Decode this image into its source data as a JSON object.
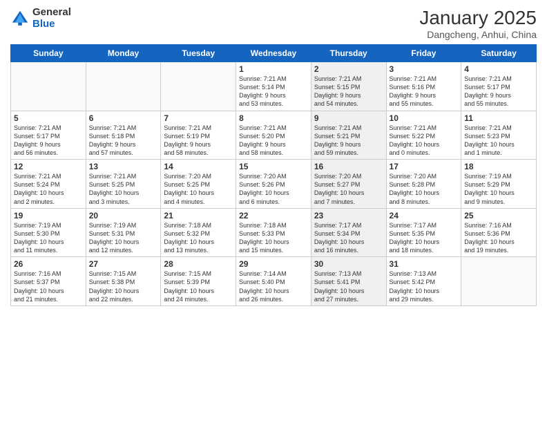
{
  "logo": {
    "general": "General",
    "blue": "Blue"
  },
  "title": "January 2025",
  "subtitle": "Dangcheng, Anhui, China",
  "headers": [
    "Sunday",
    "Monday",
    "Tuesday",
    "Wednesday",
    "Thursday",
    "Friday",
    "Saturday"
  ],
  "weeks": [
    [
      {
        "day": "",
        "info": "",
        "empty": true
      },
      {
        "day": "",
        "info": "",
        "empty": true
      },
      {
        "day": "",
        "info": "",
        "empty": true
      },
      {
        "day": "1",
        "info": "Sunrise: 7:21 AM\nSunset: 5:14 PM\nDaylight: 9 hours\nand 53 minutes."
      },
      {
        "day": "2",
        "info": "Sunrise: 7:21 AM\nSunset: 5:15 PM\nDaylight: 9 hours\nand 54 minutes.",
        "shaded": true
      },
      {
        "day": "3",
        "info": "Sunrise: 7:21 AM\nSunset: 5:16 PM\nDaylight: 9 hours\nand 55 minutes."
      },
      {
        "day": "4",
        "info": "Sunrise: 7:21 AM\nSunset: 5:17 PM\nDaylight: 9 hours\nand 55 minutes."
      }
    ],
    [
      {
        "day": "5",
        "info": "Sunrise: 7:21 AM\nSunset: 5:17 PM\nDaylight: 9 hours\nand 56 minutes."
      },
      {
        "day": "6",
        "info": "Sunrise: 7:21 AM\nSunset: 5:18 PM\nDaylight: 9 hours\nand 57 minutes."
      },
      {
        "day": "7",
        "info": "Sunrise: 7:21 AM\nSunset: 5:19 PM\nDaylight: 9 hours\nand 58 minutes."
      },
      {
        "day": "8",
        "info": "Sunrise: 7:21 AM\nSunset: 5:20 PM\nDaylight: 9 hours\nand 58 minutes."
      },
      {
        "day": "9",
        "info": "Sunrise: 7:21 AM\nSunset: 5:21 PM\nDaylight: 9 hours\nand 59 minutes.",
        "shaded": true
      },
      {
        "day": "10",
        "info": "Sunrise: 7:21 AM\nSunset: 5:22 PM\nDaylight: 10 hours\nand 0 minutes."
      },
      {
        "day": "11",
        "info": "Sunrise: 7:21 AM\nSunset: 5:23 PM\nDaylight: 10 hours\nand 1 minute."
      }
    ],
    [
      {
        "day": "12",
        "info": "Sunrise: 7:21 AM\nSunset: 5:24 PM\nDaylight: 10 hours\nand 2 minutes."
      },
      {
        "day": "13",
        "info": "Sunrise: 7:21 AM\nSunset: 5:25 PM\nDaylight: 10 hours\nand 3 minutes."
      },
      {
        "day": "14",
        "info": "Sunrise: 7:20 AM\nSunset: 5:25 PM\nDaylight: 10 hours\nand 4 minutes."
      },
      {
        "day": "15",
        "info": "Sunrise: 7:20 AM\nSunset: 5:26 PM\nDaylight: 10 hours\nand 6 minutes."
      },
      {
        "day": "16",
        "info": "Sunrise: 7:20 AM\nSunset: 5:27 PM\nDaylight: 10 hours\nand 7 minutes.",
        "shaded": true
      },
      {
        "day": "17",
        "info": "Sunrise: 7:20 AM\nSunset: 5:28 PM\nDaylight: 10 hours\nand 8 minutes."
      },
      {
        "day": "18",
        "info": "Sunrise: 7:19 AM\nSunset: 5:29 PM\nDaylight: 10 hours\nand 9 minutes."
      }
    ],
    [
      {
        "day": "19",
        "info": "Sunrise: 7:19 AM\nSunset: 5:30 PM\nDaylight: 10 hours\nand 11 minutes."
      },
      {
        "day": "20",
        "info": "Sunrise: 7:19 AM\nSunset: 5:31 PM\nDaylight: 10 hours\nand 12 minutes."
      },
      {
        "day": "21",
        "info": "Sunrise: 7:18 AM\nSunset: 5:32 PM\nDaylight: 10 hours\nand 13 minutes."
      },
      {
        "day": "22",
        "info": "Sunrise: 7:18 AM\nSunset: 5:33 PM\nDaylight: 10 hours\nand 15 minutes."
      },
      {
        "day": "23",
        "info": "Sunrise: 7:17 AM\nSunset: 5:34 PM\nDaylight: 10 hours\nand 16 minutes.",
        "shaded": true
      },
      {
        "day": "24",
        "info": "Sunrise: 7:17 AM\nSunset: 5:35 PM\nDaylight: 10 hours\nand 18 minutes."
      },
      {
        "day": "25",
        "info": "Sunrise: 7:16 AM\nSunset: 5:36 PM\nDaylight: 10 hours\nand 19 minutes."
      }
    ],
    [
      {
        "day": "26",
        "info": "Sunrise: 7:16 AM\nSunset: 5:37 PM\nDaylight: 10 hours\nand 21 minutes."
      },
      {
        "day": "27",
        "info": "Sunrise: 7:15 AM\nSunset: 5:38 PM\nDaylight: 10 hours\nand 22 minutes."
      },
      {
        "day": "28",
        "info": "Sunrise: 7:15 AM\nSunset: 5:39 PM\nDaylight: 10 hours\nand 24 minutes."
      },
      {
        "day": "29",
        "info": "Sunrise: 7:14 AM\nSunset: 5:40 PM\nDaylight: 10 hours\nand 26 minutes."
      },
      {
        "day": "30",
        "info": "Sunrise: 7:13 AM\nSunset: 5:41 PM\nDaylight: 10 hours\nand 27 minutes.",
        "shaded": true
      },
      {
        "day": "31",
        "info": "Sunrise: 7:13 AM\nSunset: 5:42 PM\nDaylight: 10 hours\nand 29 minutes."
      },
      {
        "day": "",
        "info": "",
        "empty": true
      }
    ]
  ]
}
